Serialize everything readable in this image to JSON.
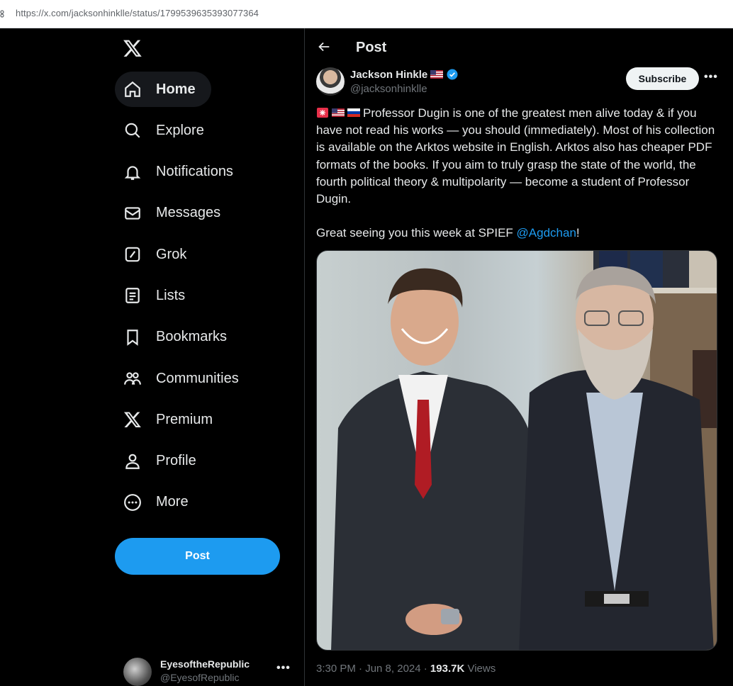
{
  "browser": {
    "url": "https://x.com/jacksonhinklle/status/1799539635393077364"
  },
  "sidebar": {
    "items": [
      {
        "label": "Home",
        "icon": "home-icon"
      },
      {
        "label": "Explore",
        "icon": "search-icon"
      },
      {
        "label": "Notifications",
        "icon": "bell-icon"
      },
      {
        "label": "Messages",
        "icon": "envelope-icon"
      },
      {
        "label": "Grok",
        "icon": "grok-icon"
      },
      {
        "label": "Lists",
        "icon": "list-icon"
      },
      {
        "label": "Bookmarks",
        "icon": "bookmark-icon"
      },
      {
        "label": "Communities",
        "icon": "communities-icon"
      },
      {
        "label": "Premium",
        "icon": "x-logo-icon"
      },
      {
        "label": "Profile",
        "icon": "person-icon"
      },
      {
        "label": "More",
        "icon": "more-circle-icon"
      }
    ],
    "post_button": "Post",
    "account": {
      "name": "EyesoftheRepublic",
      "handle": "@EyesofRepublic"
    }
  },
  "post": {
    "header_title": "Post",
    "author_name": "Jackson Hinkle",
    "author_handle": "@jacksonhinklle",
    "subscribe_label": "Subscribe",
    "text_para1": "Professor Dugin is one of the greatest men alive today & if you have not read his works — you should (immediately). Most of his collection is available on the Arktos website in English. Arktos also has cheaper PDF formats of the books. If you aim to truly grasp the state of the world, the fourth political theory & multipolarity — become a student of Professor Dugin.",
    "text_para2_prefix": "Great seeing you this week at SPIEF ",
    "text_mention": "@Agdchan",
    "text_para2_suffix": "!",
    "timestamp": "3:30 PM · Jun 8, 2024 · ",
    "views_count": "193.7K",
    "views_label": " Views"
  },
  "colors": {
    "accent": "#1d9bf0",
    "background": "#000000",
    "text": "#e7e9ea",
    "muted": "#71767b"
  }
}
